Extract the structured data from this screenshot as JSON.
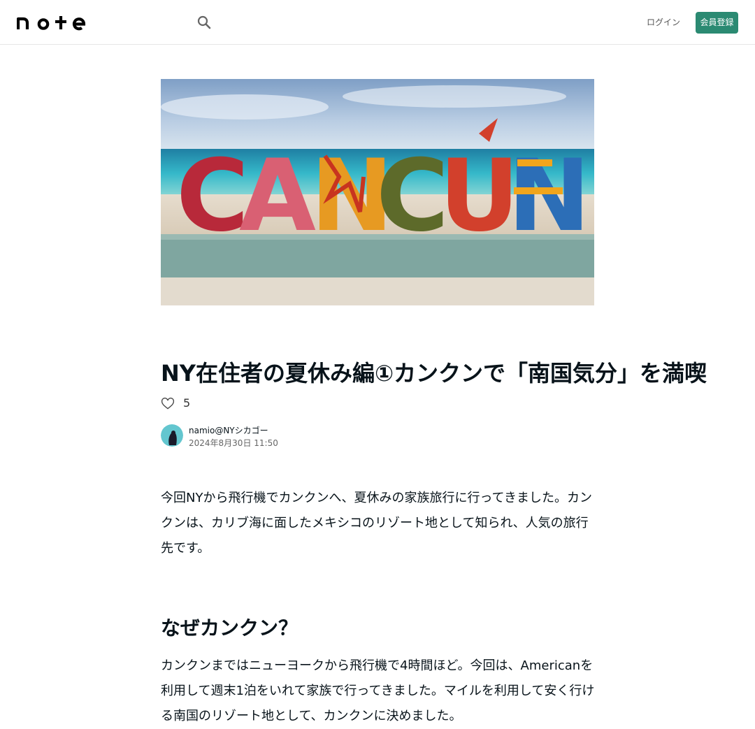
{
  "header": {
    "logo_text": "note",
    "login_label": "ログイン",
    "signup_label": "会員登録"
  },
  "hero": {
    "sign_text": "CANCÚN"
  },
  "article": {
    "title": "NY在住者の夏休み編①カンクンで「南国気分」を満喫",
    "likes": "5",
    "author": "namio@NYシカゴー",
    "date": "2024年8月30日 11:50",
    "intro": "今回NYから飛行機でカンクンへ、夏休みの家族旅行に行ってきました。カンクンは、カリブ海に面したメキシコのリゾート地として知られ、人気の旅行先です。",
    "section_heading": "なぜカンクン？",
    "section_text": "カンクンまではニューヨークから飛行機で4時間ほど。今回は、Americanを利用して週末1泊をいれて家族で行ってきました。マイルを利用して安く行ける南国のリゾート地として、カンクンに決めました。"
  },
  "colors": {
    "accent": "#2b8a72",
    "text": "#08131a"
  }
}
